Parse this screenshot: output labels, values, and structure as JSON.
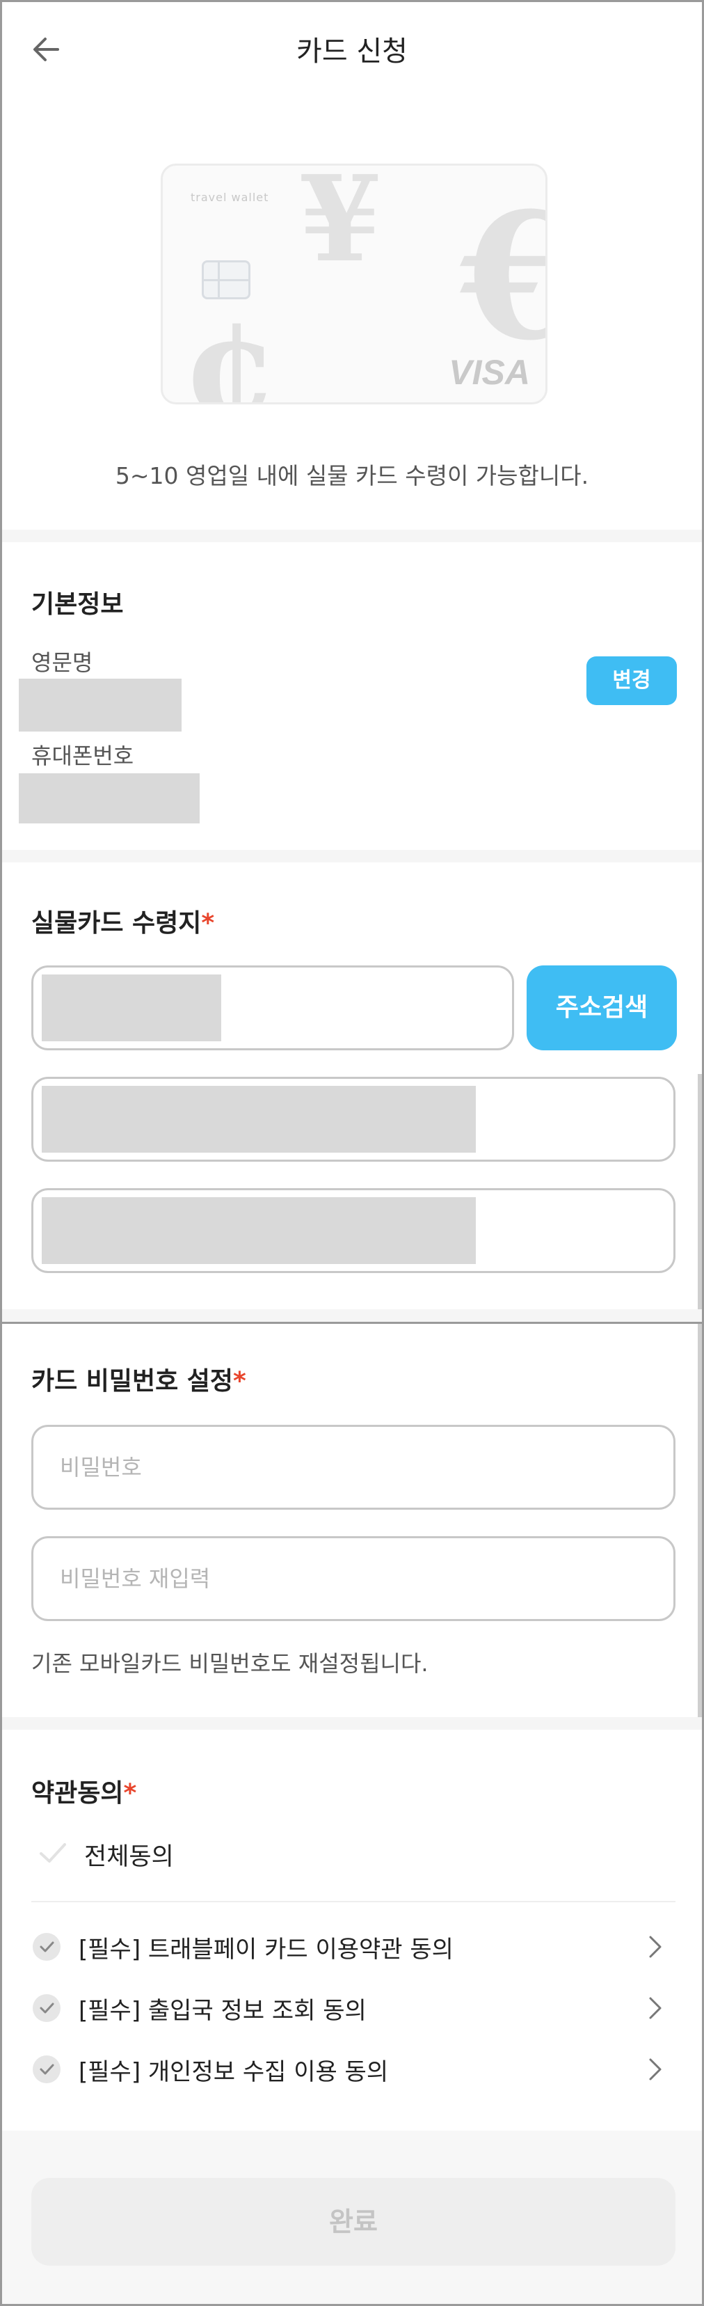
{
  "header": {
    "title": "카드 신청",
    "back_icon": "arrow-left-icon"
  },
  "card": {
    "brand_text": "travel wallet",
    "network": "VISA",
    "notice": "5~10 영업일 내에 실물 카드 수령이 가능합니다."
  },
  "basic_info": {
    "title": "기본정보",
    "english_name_label": "영문명",
    "english_name_value_masked": true,
    "phone_label": "휴대폰번호",
    "phone_value_masked": true,
    "change_button": "변경",
    "accent_color": "#3fbdf3"
  },
  "address": {
    "title": "실물카드 수령지",
    "required_mark": "*",
    "search_button": "주소검색",
    "fields_masked": [
      true,
      true,
      true
    ]
  },
  "pin": {
    "title": "카드 비밀번호 설정",
    "required_mark": "*",
    "password_placeholder": "비밀번호",
    "password_confirm_placeholder": "비밀번호 재입력",
    "helper": "기존 모바일카드 비밀번호도 재설정됩니다."
  },
  "terms": {
    "title": "약관동의",
    "required_mark": "*",
    "agree_all_label": "전체동의",
    "items": [
      {
        "label": "[필수] 트래블페이 카드 이용약관 동의"
      },
      {
        "label": "[필수] 출입국 정보 조회 동의"
      },
      {
        "label": "[필수] 개인정보 수집 이용 동의"
      }
    ]
  },
  "footer": {
    "complete_button": "완료"
  },
  "colors": {
    "required_star": "#e8452c",
    "disabled_button_bg": "#eeeeee",
    "disabled_button_text": "#c4c4c4"
  }
}
